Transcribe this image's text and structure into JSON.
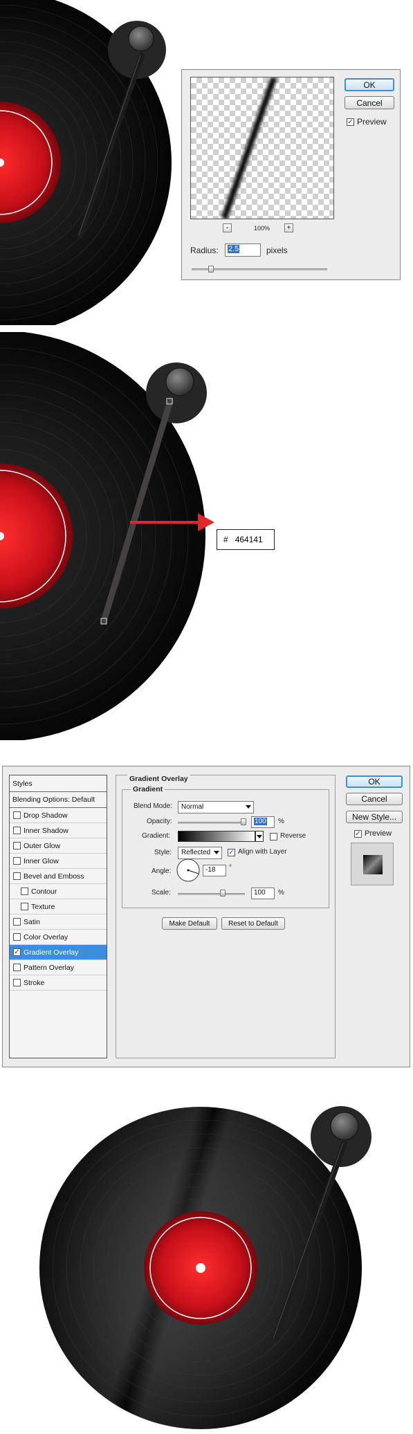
{
  "blur_dialog": {
    "ok_label": "OK",
    "cancel_label": "Cancel",
    "preview_label": "Preview",
    "preview_checked": true,
    "zoom_minus": "-",
    "zoom_level": "100%",
    "zoom_plus": "+",
    "radius_label": "Radius:",
    "radius_value": "2.5",
    "radius_unit": "pixels",
    "accent_color": "#3d8fd4"
  },
  "color_callout": {
    "hash": "#",
    "hex_value": "464141",
    "arrow_color": "#e0282c"
  },
  "layer_style": {
    "styles_header": "Styles",
    "blending_options": "Blending Options: Default",
    "items": [
      {
        "label": "Drop Shadow",
        "checked": false,
        "indent": false
      },
      {
        "label": "Inner Shadow",
        "checked": false,
        "indent": false
      },
      {
        "label": "Outer Glow",
        "checked": false,
        "indent": false
      },
      {
        "label": "Inner Glow",
        "checked": false,
        "indent": false
      },
      {
        "label": "Bevel and Emboss",
        "checked": false,
        "indent": false
      },
      {
        "label": "Contour",
        "checked": false,
        "indent": true
      },
      {
        "label": "Texture",
        "checked": false,
        "indent": true
      },
      {
        "label": "Satin",
        "checked": false,
        "indent": false
      },
      {
        "label": "Color Overlay",
        "checked": false,
        "indent": false
      },
      {
        "label": "Gradient Overlay",
        "checked": true,
        "indent": false,
        "active": true
      },
      {
        "label": "Pattern Overlay",
        "checked": false,
        "indent": false
      },
      {
        "label": "Stroke",
        "checked": false,
        "indent": false
      }
    ],
    "section_title": "Gradient Overlay",
    "group_title": "Gradient",
    "blend_mode_label": "Blend Mode:",
    "blend_mode_value": "Normal",
    "opacity_label": "Opacity:",
    "opacity_value": "100",
    "opacity_unit": "%",
    "opacity_fraction": 1.0,
    "gradient_label": "Gradient:",
    "reverse_label": "Reverse",
    "reverse_checked": false,
    "style_label": "Style:",
    "style_value": "Reflected",
    "align_label": "Align with Layer",
    "align_checked": true,
    "angle_label": "Angle:",
    "angle_value": "-18",
    "angle_unit": "°",
    "scale_label": "Scale:",
    "scale_value": "100",
    "scale_unit": "%",
    "scale_fraction": 0.67,
    "make_default_label": "Make Default",
    "reset_default_label": "Reset to Default",
    "ok_label": "OK",
    "cancel_label": "Cancel",
    "new_style_label": "New Style...",
    "preview_label": "Preview",
    "preview_checked": true,
    "active_color": "#3b8ede"
  },
  "record_colors": {
    "vinyl": "#141414",
    "label_red": "#c8101a",
    "tonearm": "#2e2e2e"
  }
}
